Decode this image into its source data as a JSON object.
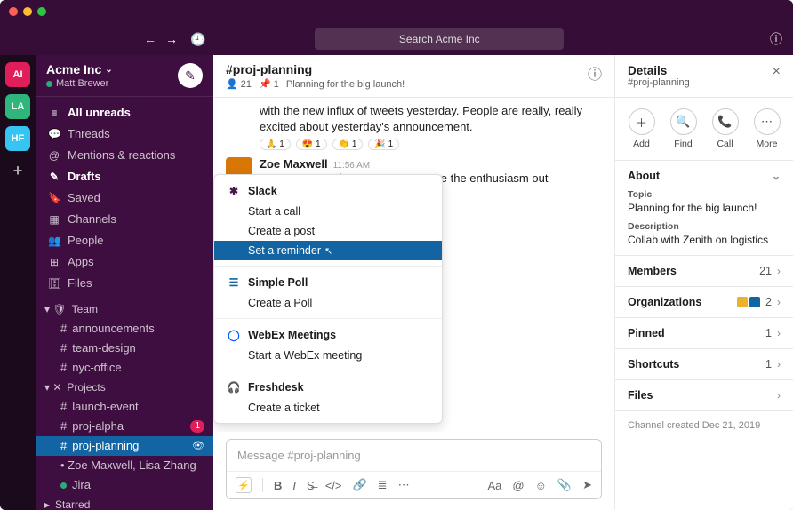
{
  "search_placeholder": "Search Acme Inc",
  "workspace": {
    "name": "Acme Inc",
    "user": "Matt Brewer"
  },
  "rail": [
    "AI",
    "LA",
    "HF"
  ],
  "sidebar": {
    "top": [
      {
        "icon": "≡",
        "label": "All unreads",
        "bold": true
      },
      {
        "icon": "💬",
        "label": "Threads"
      },
      {
        "icon": "@",
        "label": "Mentions & reactions"
      },
      {
        "icon": "✎",
        "label": "Drafts",
        "bold": true
      },
      {
        "icon": "🔖",
        "label": "Saved"
      },
      {
        "icon": "▦",
        "label": "Channels"
      },
      {
        "icon": "👥",
        "label": "People"
      },
      {
        "icon": "⊞",
        "label": "Apps"
      },
      {
        "icon": "🗄",
        "label": "Files"
      }
    ],
    "team_hdr": "Team",
    "team": [
      {
        "n": "announcements"
      },
      {
        "n": "team-design"
      },
      {
        "n": "nyc-office"
      }
    ],
    "projects_hdr": "Projects",
    "projects": [
      {
        "n": "launch-event"
      },
      {
        "n": "proj-alpha",
        "badge": "1"
      },
      {
        "n": "proj-planning",
        "active": true
      },
      {
        "n": "Zoe Maxwell, Lisa Zhang",
        "dm": true
      },
      {
        "n": "Jira",
        "app": true
      }
    ],
    "starred_hdr": "Starred"
  },
  "channel": {
    "name": "#proj-planning",
    "members": "21",
    "pins": "1",
    "topic": "Planning for the big launch!",
    "prev_text": "with the new influx of tweets yesterday. People are really, really excited about yesterday's announcement.",
    "reactions": [
      {
        "e": "🙏",
        "c": "1"
      },
      {
        "e": "😍",
        "c": "1"
      },
      {
        "e": "👏",
        "c": "1"
      },
      {
        "e": "🎉",
        "c": "1"
      }
    ],
    "msg": {
      "author": "Zoe Maxwell",
      "time": "11:56 AM",
      "text": "No! It was my pleasure! Great to see the enthusiasm out"
    },
    "composer_placeholder": "Message #proj-planning"
  },
  "shortcuts": [
    {
      "title": "Slack",
      "icon": "sl",
      "items": [
        "Start a call",
        "Create a post",
        "Set a reminder"
      ],
      "hl": 2
    },
    {
      "title": "Simple Poll",
      "icon": "sp",
      "items": [
        "Create a Poll"
      ]
    },
    {
      "title": "WebEx Meetings",
      "icon": "wx",
      "items": [
        "Start a WebEx meeting"
      ]
    },
    {
      "title": "Freshdesk",
      "icon": "fd",
      "items": [
        "Create a ticket"
      ]
    }
  ],
  "details": {
    "title": "Details",
    "sub": "#proj-planning",
    "actions": [
      {
        "i": "＋",
        "l": "Add"
      },
      {
        "i": "🔍",
        "l": "Find"
      },
      {
        "i": "📞",
        "l": "Call"
      },
      {
        "i": "⋯",
        "l": "More"
      }
    ],
    "about_hdr": "About",
    "topic_label": "Topic",
    "topic_val": "Planning for the big launch!",
    "desc_label": "Description",
    "desc_val": "Collab with Zenith on logistics",
    "rows": [
      {
        "l": "Members",
        "v": "21"
      },
      {
        "l": "Organizations",
        "v": "2",
        "org": true
      },
      {
        "l": "Pinned",
        "v": "1"
      },
      {
        "l": "Shortcuts",
        "v": "1"
      },
      {
        "l": "Files",
        "v": ""
      }
    ],
    "created": "Channel created Dec 21, 2019"
  }
}
